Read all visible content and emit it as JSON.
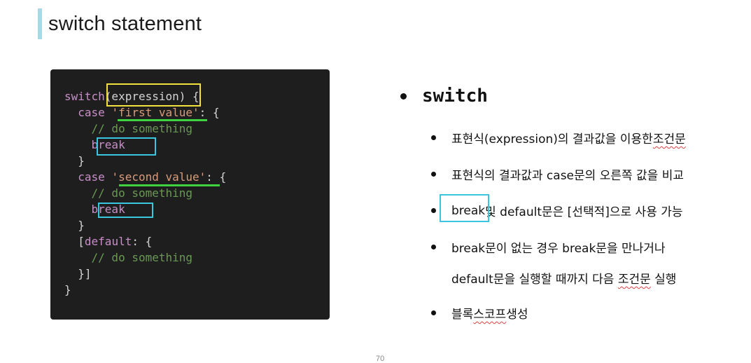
{
  "slide": {
    "title": "switch statement",
    "page_number": "70"
  },
  "code": {
    "l1_kw": "switch",
    "l1_expr": "(expression)",
    "l1_rest": " {",
    "l2_kw": "  case ",
    "l2_str": "'first value'",
    "l2_rest": ": {",
    "l3": "    // do something",
    "l4": "    break",
    "l5": "  }",
    "l6_kw": "  case ",
    "l6_str": "'second value'",
    "l6_rest": ": {",
    "l7": "    // do something",
    "l8": "    break",
    "l9": "  }",
    "l10_bracket": "  [",
    "l10_kw": "default",
    "l10_rest": ": {",
    "l11": "    // do something",
    "l12": "  }]",
    "l13": "}"
  },
  "bullets": {
    "main": "switch",
    "b1_text": "표현식(expression)의 결과값을 이용한 ",
    "b1_squiggle": "조건문",
    "b2": "표현식의 결과값과 case문의 오른쪽 값을 비교",
    "b3_break": "break",
    "b3_rest": " 및 default문은 [선택적]으로 사용 가능",
    "b4_line1": "break문이 없는 경우 break문을 만나거나",
    "b4_line2_a": "default문을 실행할 때까지 다음 ",
    "b4_line2_squiggle": "조건문",
    "b4_line2_b": " 실행",
    "b5_a": "블록 ",
    "b5_squiggle": "스코프",
    "b5_b": " 생성"
  },
  "colors": {
    "title_accent": "#a9d8e6",
    "highlight_yellow": "#f0e23a",
    "highlight_cyan": "#3ac6e0",
    "underline_green": "#3fd13f"
  }
}
